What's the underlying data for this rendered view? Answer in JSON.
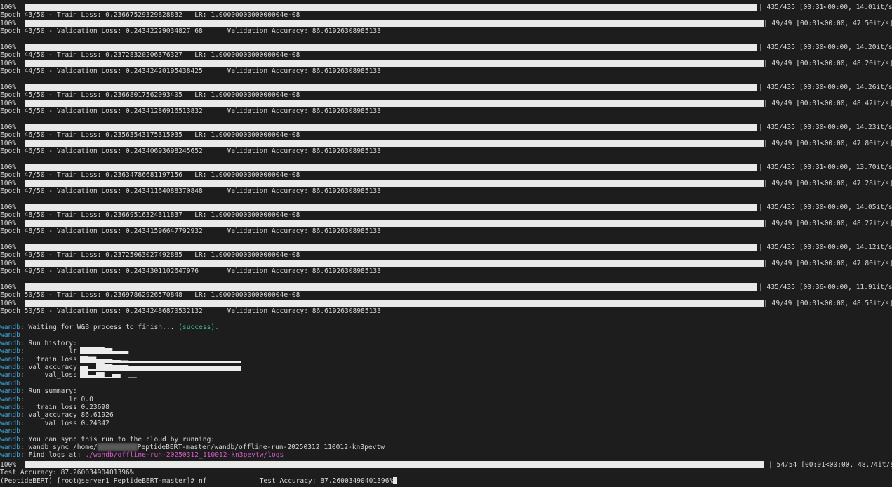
{
  "training_blocks": [
    {
      "train_bar": {
        "percent": "100%",
        "suffix": "| 435/435 [00:31<00:00, 14.01it/s]"
      },
      "train_line": "Epoch 43/50 - Train Loss: 0.23667529329828832   LR: 1.0000000000000004e-08",
      "val_bar": {
        "percent": "100%",
        "suffix": "| 49/49 [00:01<00:00, 47.50it/s]"
      },
      "val_line": "Epoch 43/50 - Validation Loss: 0.24342229034827 68      Validation Accuracy: 86.61926308985133"
    },
    {
      "train_bar": {
        "percent": "100%",
        "suffix": "| 435/435 [00:30<00:00, 14.20it/s]"
      },
      "train_line": "Epoch 44/50 - Train Loss: 0.23728320206376327   LR: 1.0000000000000004e-08",
      "val_bar": {
        "percent": "100%",
        "suffix": "| 49/49 [00:01<00:00, 48.20it/s]"
      },
      "val_line": "Epoch 44/50 - Validation Loss: 0.24342420195438425      Validation Accuracy: 86.61926308985133"
    },
    {
      "train_bar": {
        "percent": "100%",
        "suffix": "| 435/435 [00:30<00:00, 14.26it/s]"
      },
      "train_line": "Epoch 45/50 - Train Loss: 0.23668017562093405   LR: 1.0000000000000004e-08",
      "val_bar": {
        "percent": "100%",
        "suffix": "| 49/49 [00:01<00:00, 48.42it/s]"
      },
      "val_line": "Epoch 45/50 - Validation Loss: 0.24341286916513832      Validation Accuracy: 86.61926308985133"
    },
    {
      "train_bar": {
        "percent": "100%",
        "suffix": "| 435/435 [00:30<00:00, 14.23it/s]"
      },
      "train_line": "Epoch 46/50 - Train Loss: 0.23563543175315035   LR: 1.0000000000000004e-08",
      "val_bar": {
        "percent": "100%",
        "suffix": "| 49/49 [00:01<00:00, 47.80it/s]"
      },
      "val_line": "Epoch 46/50 - Validation Loss: 0.24340693698245652      Validation Accuracy: 86.61926308985133"
    },
    {
      "train_bar": {
        "percent": "100%",
        "suffix": "| 435/435 [00:31<00:00, 13.70it/s]"
      },
      "train_line": "Epoch 47/50 - Train Loss: 0.23634786681197156   LR: 1.0000000000000004e-08",
      "val_bar": {
        "percent": "100%",
        "suffix": "| 49/49 [00:01<00:00, 47.28it/s]"
      },
      "val_line": "Epoch 47/50 - Validation Loss: 0.24341164088370848      Validation Accuracy: 86.61926308985133"
    },
    {
      "train_bar": {
        "percent": "100%",
        "suffix": "| 435/435 [00:30<00:00, 14.05it/s]"
      },
      "train_line": "Epoch 48/50 - Train Loss: 0.23669516324311837   LR: 1.0000000000000004e-08",
      "val_bar": {
        "percent": "100%",
        "suffix": "| 49/49 [00:01<00:00, 48.22it/s]"
      },
      "val_line": "Epoch 48/50 - Validation Loss: 0.24341596647792932      Validation Accuracy: 86.61926308985133"
    },
    {
      "train_bar": {
        "percent": "100%",
        "suffix": "| 435/435 [00:30<00:00, 14.12it/s]"
      },
      "train_line": "Epoch 49/50 - Train Loss: 0.23725063027492885   LR: 1.0000000000000004e-08",
      "val_bar": {
        "percent": "100%",
        "suffix": "| 49/49 [00:01<00:00, 47.80it/s]"
      },
      "val_line": "Epoch 49/50 - Validation Loss: 0.2434301102647976       Validation Accuracy: 86.61926308985133"
    },
    {
      "train_bar": {
        "percent": "100%",
        "suffix": "| 435/435 [00:36<00:00, 11.91it/s]"
      },
      "train_line": "Epoch 50/50 - Train Loss: 0.23697862926570848   LR: 1.0000000000000004e-08",
      "val_bar": {
        "percent": "100%",
        "suffix": "| 49/49 [00:01<00:00, 48.53it/s]"
      },
      "val_line": "Epoch 50/50 - Validation Loss: 0.24342486870532132      Validation Accuracy: 86.61926308985133"
    }
  ],
  "wandb": {
    "prefix": "wandb",
    "waiting": ": Waiting for W&B process to finish... ",
    "success": "(success).",
    "history_header": ": Run history:",
    "history": [
      {
        "label": ":           lr ",
        "name": "lr"
      },
      {
        "label": ":   train_loss ",
        "name": "train_loss"
      },
      {
        "label": ": val_accuracy ",
        "name": "val_accuracy"
      },
      {
        "label": ":     val_loss ",
        "name": "val_loss"
      }
    ],
    "summary_header": ": Run summary:",
    "summary": [
      ":           lr 0.0",
      ":   train_loss 0.23698",
      ": val_accuracy 86.61926",
      ":     val_loss 0.24342"
    ],
    "sync_hint": ": You can sync this run to the cloud by running:",
    "sync_cmd_a": ": wandb sync /home/",
    "sync_cmd_b": "PeptideBERT-master/wandb/offline-run-20250312_110012-kn3pevtw",
    "find_logs": ": Find logs at: ",
    "logs_path": "./wandb/offline-run-20250312_110012-kn3pevtw/logs"
  },
  "test_bar": {
    "percent": "100%",
    "suffix": "| 54/54 [00:01<00:00, 48.74it/s]"
  },
  "test_accuracy": "Test Accuracy: 87.26003490401396%",
  "prompt": "(PeptideBERT) [root@server1 PeptideBERT-master]# nf             Test Accuracy: 87.26003490401396%",
  "colors": {
    "background": "#1d1d1d",
    "text": "#d6d6d6",
    "wandb": "#3aa7d8",
    "success": "#3cc08a",
    "path": "#d45bc6"
  }
}
